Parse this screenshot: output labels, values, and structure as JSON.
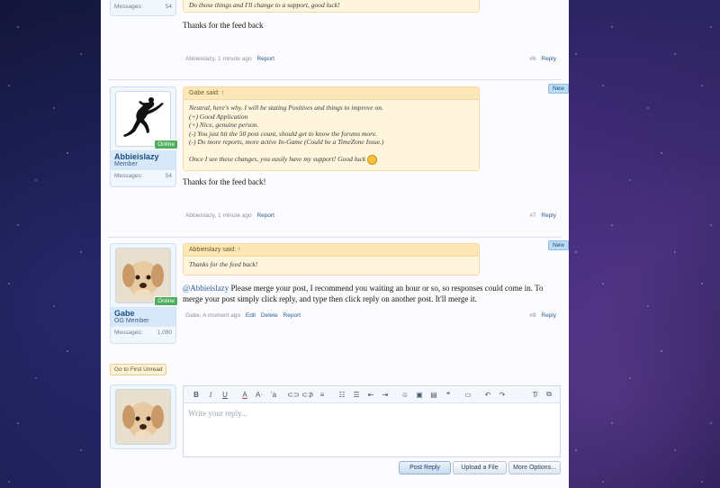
{
  "posts": [
    {
      "quote_tail": "Do those things and I'll change to a support, good luck!",
      "content": "Thanks for the feed back",
      "author_short": "Abbieislazy",
      "time": "1 minute ago",
      "actions": [
        "Report"
      ],
      "number": "#6",
      "reply": "Reply",
      "stats_label": "Messages:",
      "stats_value": "54"
    },
    {
      "author": "Abbieislazy",
      "role": "Member",
      "online": "Online",
      "stats_label": "Messages:",
      "stats_value": "54",
      "new_badge": "New",
      "quote_author": "Gabe said: ↑",
      "quote_lines": [
        "Neutral, here's why. I will be stating Positives and things to improve on.",
        "(+) Good Application",
        "(+) Nice, genuine person.",
        "(-) You just hit the 50 post count, should get to know the forums more.",
        "(-) Do more reports, more active In-Game (Could be a TimeZone Issue.)",
        "",
        "Once I see these changes, you easily have my support! Good luck"
      ],
      "content": "Thanks for the feed back!",
      "time": "1 minute ago",
      "actions": [
        "Report"
      ],
      "number": "#7",
      "reply": "Reply"
    },
    {
      "author": "Gabe",
      "role": "OG Member",
      "online": "Online",
      "stats_label": "Messages:",
      "stats_value": "1,090",
      "new_badge": "New",
      "quote_author": "Abbieislazy said: ↑",
      "quote_lines": [
        "Thanks for the feed back!"
      ],
      "mention": "@Abbieislazy",
      "content": " Please merge your post, I recommend you waiting an hour or so, so responses could come in. To merge your post simply click reply, and type then click reply on another post. It'll merge it.",
      "time": "A moment ago",
      "actions": [
        "Edit",
        "Delete",
        "Report"
      ],
      "number": "#8",
      "reply": "Reply"
    }
  ],
  "first_unread": "Go to First Unread",
  "editor": {
    "placeholder": "Write your reply...",
    "toolbar_icons": [
      "bold-icon",
      "italic-icon",
      "underline-icon",
      "text-color-icon",
      "font-size-icon",
      "remove-format-icon",
      "link-icon",
      "unlink-icon",
      "align-icon",
      "bullet-list-icon",
      "numbered-list-icon",
      "outdent-icon",
      "indent-icon",
      "smilie-icon",
      "image-icon",
      "media-icon",
      "quote-icon",
      "code-icon",
      "undo-icon",
      "redo-icon",
      "clear-format-icon",
      "toggle-bbcode-icon"
    ]
  },
  "buttons": {
    "post_reply": "Post Reply",
    "upload": "Upload a File",
    "more_options": "More Options..."
  },
  "colors": {
    "accent": "#2a5d94",
    "online": "#4fae5b",
    "quote_bg": "#fff4dc"
  }
}
